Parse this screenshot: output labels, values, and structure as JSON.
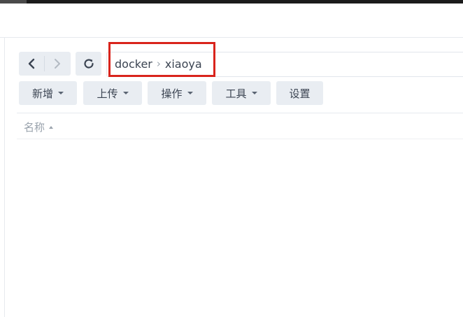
{
  "navigation": {
    "back_icon": "chevron-left-icon",
    "forward_icon": "chevron-right-icon",
    "refresh_icon": "refresh-icon"
  },
  "path": {
    "segments": [
      "docker",
      "xiaoya"
    ],
    "separator": "›"
  },
  "toolbar": {
    "create_label": "新增",
    "upload_label": "上传",
    "action_label": "操作",
    "tools_label": "工具",
    "settings_label": "设置"
  },
  "file_list": {
    "column_name": "名称",
    "sort_direction": "ascending"
  },
  "colors": {
    "highlight_border": "#d9241c",
    "button_bg": "#e9edf2",
    "text": "#3b4452",
    "muted_text": "#9aa3ad"
  }
}
